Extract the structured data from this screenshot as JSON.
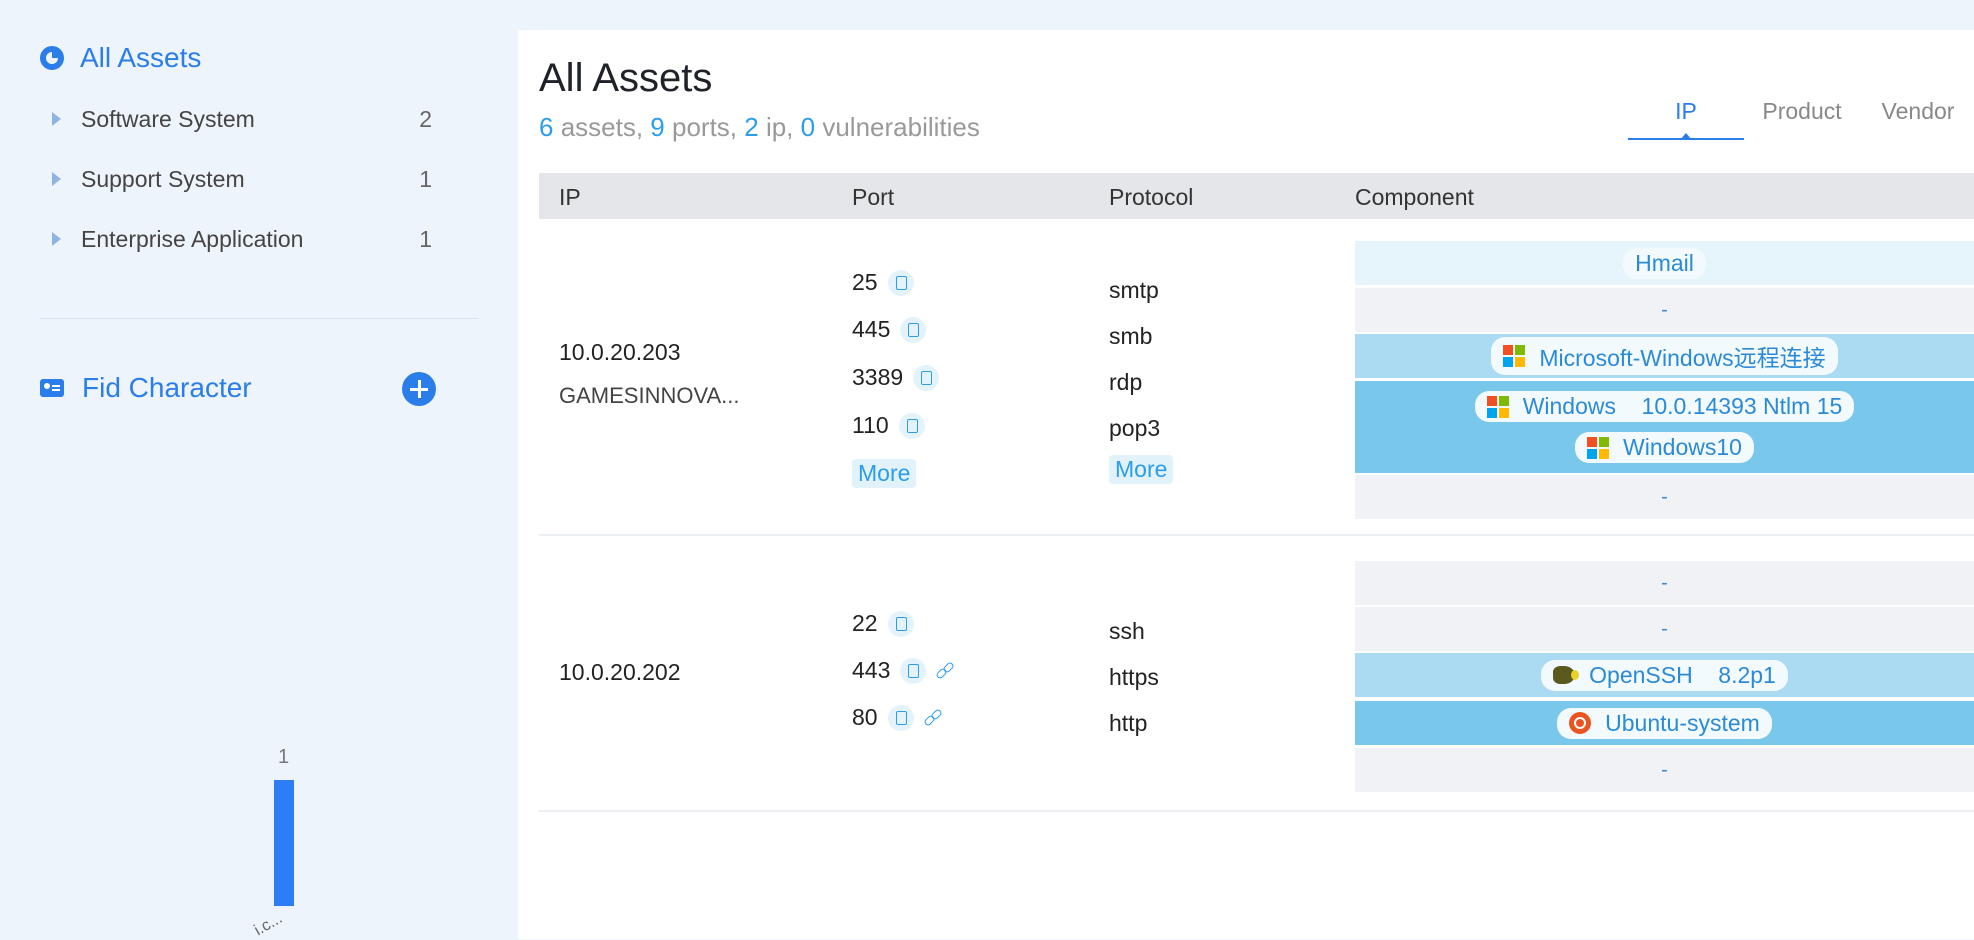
{
  "sidebar": {
    "title": "All Assets",
    "items": [
      {
        "label": "Software System",
        "count": "2"
      },
      {
        "label": "Support System",
        "count": "1"
      },
      {
        "label": "Enterprise Application",
        "count": "1"
      }
    ],
    "fid_label": "Fid Character",
    "mini_chart": {
      "value": "1",
      "tick": "i.c..."
    }
  },
  "main": {
    "title": "All Assets",
    "summary": {
      "assets_num": "6",
      "assets_label": " assets, ",
      "ports_num": "9",
      "ports_label": " ports, ",
      "ip_num": "2",
      "ip_label": " ip, ",
      "vuln_num": "0",
      "vuln_label": " vulnerabilities"
    },
    "tabs": [
      "IP",
      "Product",
      "Vendor"
    ],
    "columns": [
      "IP",
      "Port",
      "Protocol",
      "Component"
    ],
    "rows": [
      {
        "ip": "10.0.20.203",
        "ip_sub": "GAMESINNOVA...",
        "ports": [
          "25",
          "445",
          "3389",
          "110"
        ],
        "protocols": [
          "smtp",
          "smb",
          "rdp",
          "pop3"
        ],
        "more_label": "More",
        "components": [
          {
            "label": "Hmail",
            "icon": null
          },
          {
            "label": "-",
            "icon": null
          },
          {
            "label": "Microsoft-Windows远程连接",
            "icon": "windows-logo"
          },
          {
            "label": "Windows    10.0.14393 Ntlm 15",
            "icon": "windows-logo"
          },
          {
            "label": "Windows10",
            "icon": "windows-logo"
          },
          {
            "label": "-",
            "icon": null
          }
        ]
      },
      {
        "ip": "10.0.20.202",
        "ports": [
          "22",
          "443",
          "80"
        ],
        "protocols": [
          "ssh",
          "https",
          "http"
        ],
        "components": [
          {
            "label": "-",
            "icon": null
          },
          {
            "label": "-",
            "icon": null
          },
          {
            "label": "OpenSSH    8.2p1",
            "icon": "openssh-logo"
          },
          {
            "label": "Ubuntu-system",
            "icon": "ubuntu-logo"
          },
          {
            "label": "-",
            "icon": null
          }
        ]
      }
    ]
  },
  "colors": {
    "accent": "#2b7de9",
    "link": "#2b9de9"
  }
}
